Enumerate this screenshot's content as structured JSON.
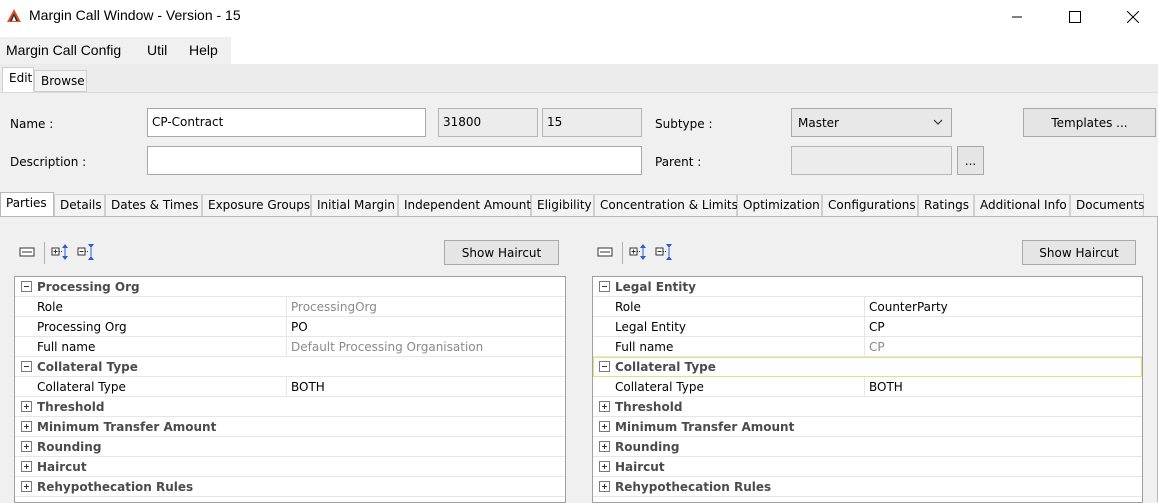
{
  "window": {
    "title": "Margin Call Window - Version - 15"
  },
  "menu": [
    "Margin Call Config",
    "Util",
    "Help"
  ],
  "mode_tabs": {
    "edit": "Edit",
    "browse": "Browse"
  },
  "form": {
    "name_label": "Name :",
    "name_value": "CP-Contract",
    "id_value": "31800",
    "version_value": "15",
    "subtype_label": "Subtype :",
    "subtype_value": "Master",
    "templates_button": "Templates ...",
    "description_label": "Description :",
    "description_value": "",
    "parent_label": "Parent :",
    "parent_value": "",
    "browse_button": "..."
  },
  "tabs": [
    "Parties",
    "Details",
    "Dates & Times",
    "Exposure Groups",
    "Initial Margin",
    "Independent Amount",
    "Eligibility",
    "Concentration & Limits",
    "Optimization",
    "Configurations",
    "Ratings",
    "Additional Info",
    "Documents"
  ],
  "active_tab": "Parties",
  "left_panel": {
    "haircut_button": "Show Haircut",
    "sections": [
      {
        "title": "Processing Org",
        "expanded": true,
        "rows": [
          {
            "name": "Role",
            "value": "ProcessingOrg",
            "muted": true
          },
          {
            "name": "Processing Org",
            "value": "PO",
            "muted": false
          },
          {
            "name": "Full name",
            "value": "Default Processing Organisation",
            "muted": true
          }
        ]
      },
      {
        "title": "Collateral Type",
        "expanded": true,
        "rows": [
          {
            "name": "Collateral Type",
            "value": "BOTH",
            "muted": false
          }
        ]
      },
      {
        "title": "Threshold",
        "expanded": false,
        "rows": []
      },
      {
        "title": "Minimum Transfer Amount",
        "expanded": false,
        "rows": []
      },
      {
        "title": "Rounding",
        "expanded": false,
        "rows": []
      },
      {
        "title": "Haircut",
        "expanded": false,
        "rows": []
      },
      {
        "title": "Rehypothecation Rules",
        "expanded": false,
        "rows": []
      }
    ]
  },
  "right_panel": {
    "haircut_button": "Show Haircut",
    "sections": [
      {
        "title": "Legal Entity",
        "expanded": true,
        "rows": [
          {
            "name": "Role",
            "value": "CounterParty",
            "muted": false
          },
          {
            "name": "Legal Entity",
            "value": "CP",
            "muted": false
          },
          {
            "name": "Full name",
            "value": "CP",
            "muted": true
          }
        ]
      },
      {
        "title": "Collateral Type",
        "expanded": true,
        "selected": true,
        "rows": [
          {
            "name": "Collateral Type",
            "value": "BOTH",
            "muted": false
          }
        ]
      },
      {
        "title": "Threshold",
        "expanded": false,
        "rows": []
      },
      {
        "title": "Minimum Transfer Amount",
        "expanded": false,
        "rows": []
      },
      {
        "title": "Rounding",
        "expanded": false,
        "rows": []
      },
      {
        "title": "Haircut",
        "expanded": false,
        "rows": []
      },
      {
        "title": "Rehypothecation Rules",
        "expanded": false,
        "rows": []
      }
    ]
  },
  "colors": {
    "app_icon": "#d9532c",
    "section_text": "#4b4b4b",
    "muted_value": "#8a8a8a",
    "selection_outline": "#e7e07a"
  }
}
